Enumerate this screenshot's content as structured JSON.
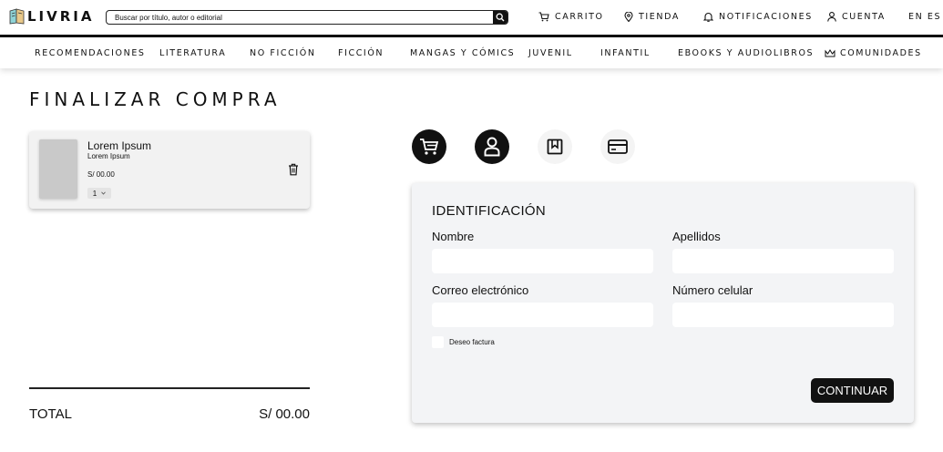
{
  "header": {
    "brand": "LIVRIA",
    "search_placeholder": "Buscar por título, autor o editorial",
    "nav": {
      "cart": "CARRITO",
      "store": "TIENDA",
      "notifications": "NOTIFICACIONES",
      "account": "CUENTA",
      "language": "EN ES"
    }
  },
  "categories": {
    "recommendations": "RECOMENDACIONES",
    "literature": "LITERATURA",
    "nonfiction": "NO FICCIÓN",
    "fiction": "FICCIÓN",
    "mangas": "MANGAS Y CÓMICS",
    "youth": "JUVENIL",
    "kids": "INFANTIL",
    "ebooks": "EBOOKS Y AUDIOLIBROS",
    "communities": "COMUNIDADES"
  },
  "page": {
    "title": "FINALIZAR COMPRA"
  },
  "cart_item": {
    "title": "Lorem Ipsum",
    "subtitle": "Lorem Ipsum",
    "price": "S/ 00.00",
    "quantity": "1"
  },
  "total": {
    "label": "TOTAL",
    "value": "S/ 00.00"
  },
  "form": {
    "title": "IDENTIFICACIÓN",
    "first_name_label": "Nombre",
    "last_name_label": "Apellidos",
    "email_label": "Correo electrónico",
    "phone_label": "Número celular",
    "invoice_label": "Deseo factura",
    "continue_label": "CONTINUAR"
  }
}
